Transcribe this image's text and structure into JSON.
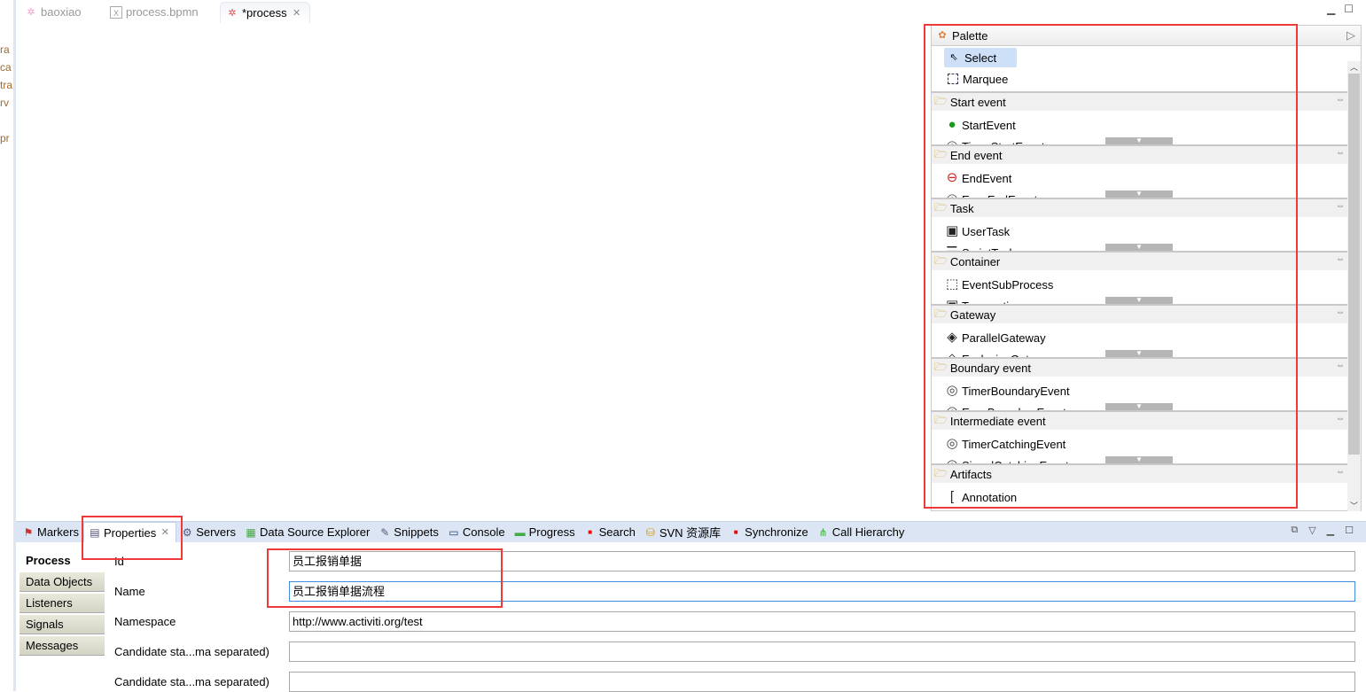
{
  "gutter": [
    "ra",
    "ca",
    "tra",
    "rv",
    "pr"
  ],
  "editor_tabs": [
    {
      "label": "baoxiao",
      "icon": "activiti-diagram-icon"
    },
    {
      "label": "process.bpmn",
      "icon": "xml-file-icon"
    },
    {
      "label": "*process",
      "icon": "activiti-diagram-icon",
      "active": true
    }
  ],
  "palette": {
    "title": "Palette",
    "tools": [
      "Select",
      "Marquee"
    ],
    "drawers": [
      {
        "label": "Start event",
        "items": [
          "StartEvent",
          "TimerStartEvent"
        ]
      },
      {
        "label": "End event",
        "items": [
          "EndEvent",
          "ErrorEndEvent"
        ]
      },
      {
        "label": "Task",
        "items": [
          "UserTask",
          "ScriptTask"
        ]
      },
      {
        "label": "Container",
        "items": [
          "EventSubProcess",
          "Transaction"
        ]
      },
      {
        "label": "Gateway",
        "items": [
          "ParallelGateway",
          "ExclusiveGateway"
        ]
      },
      {
        "label": "Boundary event",
        "items": [
          "TimerBoundaryEvent",
          "ErrorBoundaryEvent"
        ]
      },
      {
        "label": "Intermediate event",
        "items": [
          "TimerCatchingEvent",
          "SignalCatchingEvent"
        ]
      },
      {
        "label": "Artifacts",
        "items": [
          "Annotation"
        ]
      }
    ]
  },
  "panel_tabs": [
    {
      "label": "Markers"
    },
    {
      "label": "Properties",
      "active": true
    },
    {
      "label": "Servers"
    },
    {
      "label": "Data Source Explorer"
    },
    {
      "label": "Snippets"
    },
    {
      "label": "Console"
    },
    {
      "label": "Progress"
    },
    {
      "label": "Search"
    },
    {
      "label": "SVN 资源库"
    },
    {
      "label": "Synchronize"
    },
    {
      "label": "Call Hierarchy"
    }
  ],
  "side_tabs": [
    "Process",
    "Data Objects",
    "Listeners",
    "Signals",
    "Messages"
  ],
  "fields": [
    {
      "label": "Id",
      "value": "员工报销单据"
    },
    {
      "label": "Name",
      "value": "员工报销单据流程"
    },
    {
      "label": "Namespace",
      "value": "http://www.activiti.org/test"
    },
    {
      "label": "Candidate sta...ma separated)",
      "value": ""
    },
    {
      "label": "Candidate sta...ma separated)",
      "value": ""
    }
  ],
  "colors": {
    "annotation": "#f03a3a",
    "accent": "#3d8ee0"
  }
}
